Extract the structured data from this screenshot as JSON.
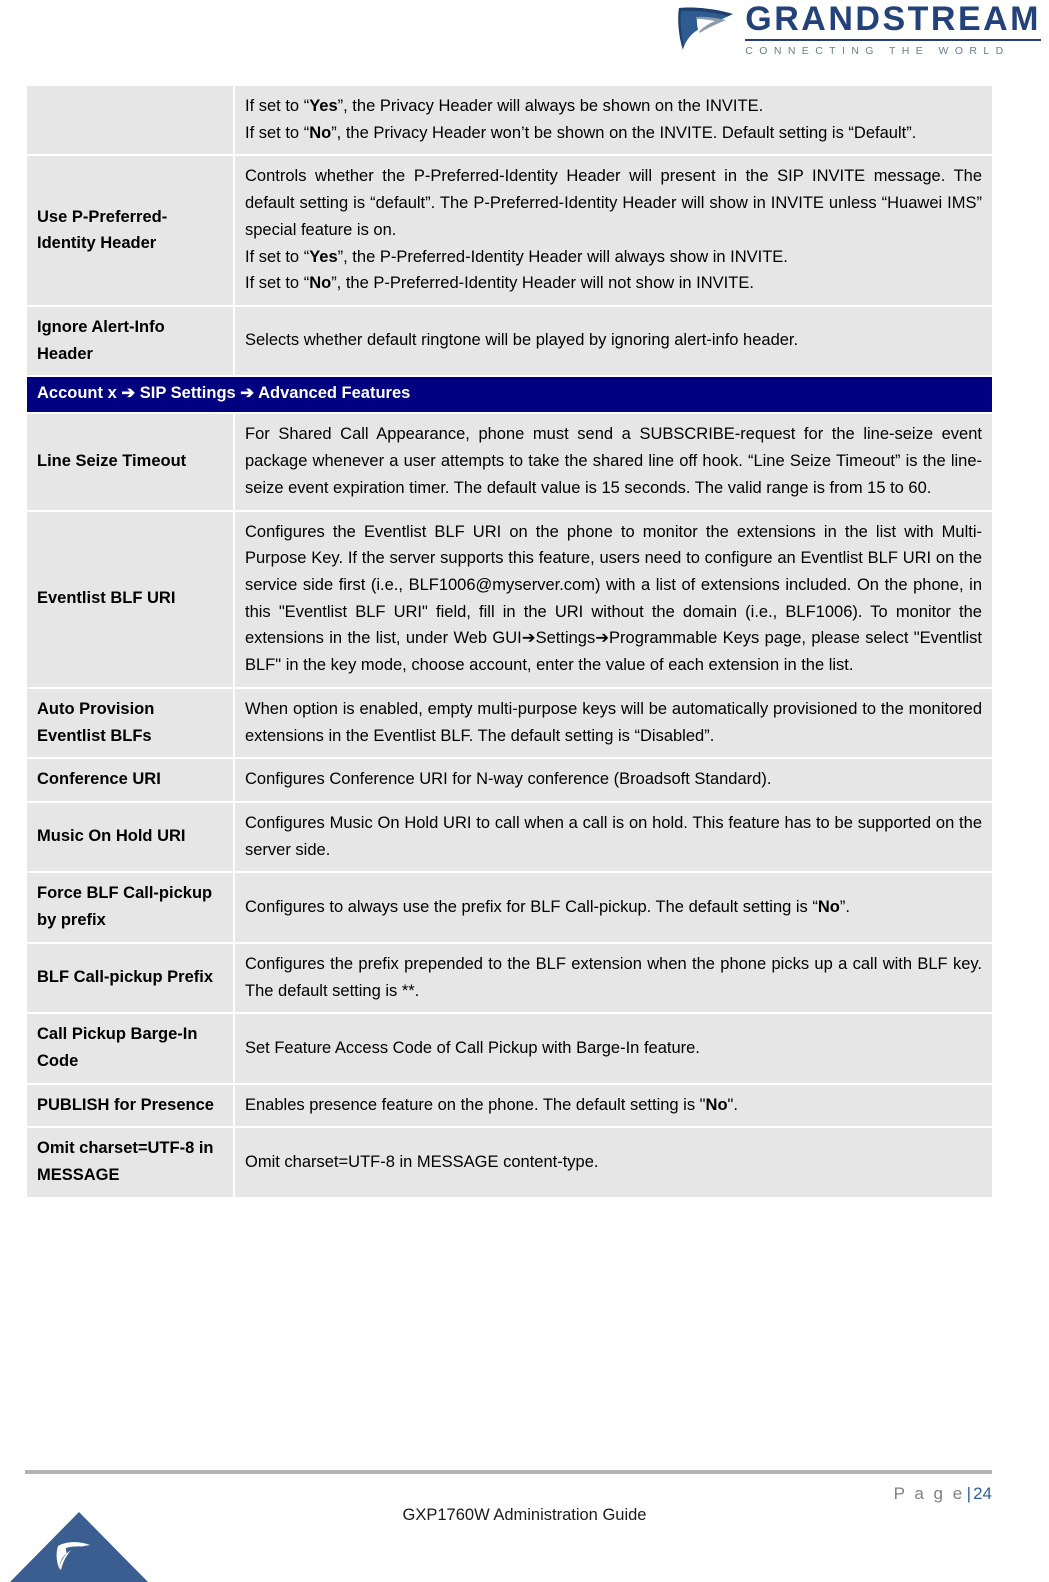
{
  "header": {
    "logo_icon": "grandstream-swoosh-logo",
    "brand_name": "GRANDSTREAM",
    "brand_tagline": "CONNECTING  THE  WORLD",
    "brand_color": "#23427a"
  },
  "document": {
    "accent_navy": "#000080",
    "cell_background": "#e6e6e6"
  },
  "table": {
    "rows": [
      {
        "type": "data",
        "label": "",
        "lines": [
          "If set to “Yes”, the Privacy Header will always be shown on the INVITE.",
          "If set to “No”, the Privacy Header won’t be shown on the INVITE. Default setting is “Default”."
        ]
      },
      {
        "type": "data",
        "label": "Use P-Preferred-Identity Header",
        "lines": [
          "Controls whether the P-Preferred-Identity Header will present in the SIP INVITE message. The default setting is “default”. The P-Preferred-Identity Header will show in INVITE unless “Huawei IMS” special feature is on.",
          "If set to “Yes”, the P-Preferred-Identity Header will always show in INVITE.",
          "If set to “No”, the P-Preferred-Identity Header will not show in INVITE."
        ]
      },
      {
        "type": "data",
        "label": "Ignore Alert-Info Header",
        "lines": [
          "Selects whether default ringtone will be played by ignoring alert-info header."
        ]
      },
      {
        "type": "section",
        "text_parts": [
          "Account x",
          "➔",
          "SIP Settings",
          "➔",
          "Advanced Features"
        ],
        "text": "Account x ➔ SIP Settings ➔ Advanced Features"
      },
      {
        "type": "data",
        "label": "Line Seize Timeout",
        "lines": [
          "For Shared Call Appearance, phone must send a SUBSCRIBE-request for the line-seize event package whenever a user attempts to take the shared line off hook. “Line Seize Timeout” is the line-seize event expiration timer. The default value is 15 seconds. The valid range is from 15 to 60."
        ]
      },
      {
        "type": "data",
        "label": "Eventlist BLF URI",
        "lines": [
          "Configures the Eventlist BLF URI on the phone to monitor the extensions in the list with Multi-Purpose Key. If the server supports this feature, users need to configure an Eventlist BLF URI on the service side first (i.e., BLF1006@myserver.com) with a list of extensions included. On the phone, in this \"Eventlist BLF URI\" field, fill in the URI without the domain (i.e., BLF1006). To monitor the extensions in the list, under Web GUI➔Settings➔Programmable Keys page, please select \"Eventlist BLF\" in the key mode, choose account, enter the value of each extension in the list."
        ]
      },
      {
        "type": "data",
        "label": "Auto Provision Eventlist BLFs",
        "lines": [
          "When option is enabled, empty multi-purpose keys will be automatically provisioned to the monitored extensions in the Eventlist BLF. The default setting is “Disabled”."
        ]
      },
      {
        "type": "data",
        "label": "Conference URI",
        "lines": [
          "Configures Conference URI for N-way conference (Broadsoft Standard)."
        ]
      },
      {
        "type": "data",
        "label": "Music On Hold URI",
        "lines": [
          "Configures Music On Hold URI to call when a call is on hold. This feature has to be supported on the server side."
        ]
      },
      {
        "type": "data",
        "label": "Force BLF Call-pickup by prefix",
        "lines": [
          "Configures to always use the prefix for BLF Call-pickup. The default setting is “No”."
        ]
      },
      {
        "type": "data",
        "label": "BLF Call-pickup Prefix",
        "lines": [
          "Configures the prefix prepended to the BLF extension when the phone picks up a call with BLF key. The default setting is **."
        ]
      },
      {
        "type": "data",
        "label": "Call Pickup Barge-In Code",
        "lines": [
          "Set Feature Access Code of Call Pickup with Barge-In feature."
        ]
      },
      {
        "type": "data",
        "label": "PUBLISH for Presence",
        "lines": [
          "Enables presence feature on the phone. The default setting is \"No\"."
        ]
      },
      {
        "type": "data",
        "label": "Omit charset=UTF-8 in MESSAGE",
        "lines": [
          "Omit charset=UTF-8 in MESSAGE content-type."
        ]
      }
    ]
  },
  "footer": {
    "page_word": "P a g e",
    "separator": "|",
    "page_number": "24",
    "title": "GXP1760W Administration Guide",
    "logo_icon": "grandstream-triangle-logo",
    "page_number_color": "#2e5fa3",
    "rule_color": "#b3b3b3"
  }
}
